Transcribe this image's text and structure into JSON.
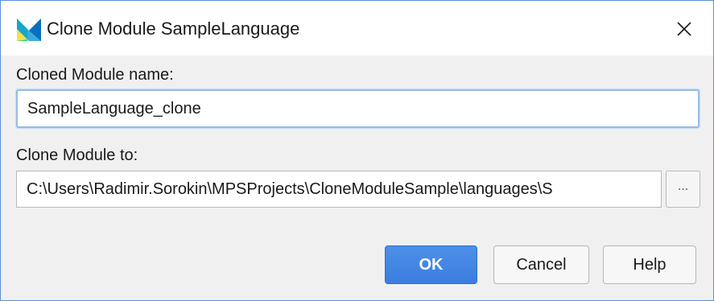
{
  "window": {
    "title": "Clone Module SampleLanguage",
    "close_icon": "close-icon",
    "app_icon": "mps-logo-icon"
  },
  "form": {
    "name_label": "Cloned Module name:",
    "name_value": "SampleLanguage_clone",
    "path_label": "Clone Module to:",
    "path_value": "C:\\Users\\Radimir.Sorokin\\MPSProjects\\CloneModuleSample\\languages\\S",
    "browse_label": "..."
  },
  "buttons": {
    "ok": "OK",
    "cancel": "Cancel",
    "help": "Help"
  },
  "colors": {
    "accent": "#3b7ddf",
    "focus_border": "#97bde8",
    "window_border": "#5b8fd6"
  }
}
